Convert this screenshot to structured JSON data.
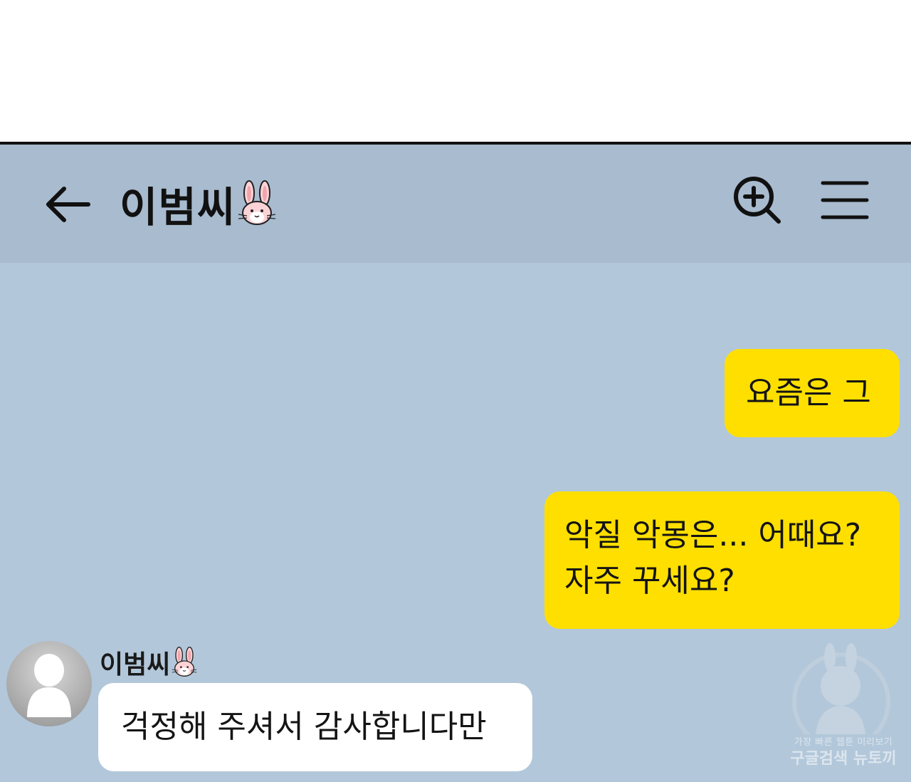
{
  "header": {
    "title": "이범씨",
    "back_icon": "arrow-left-icon",
    "search_icon": "zoom-in-search-icon",
    "menu_icon": "hamburger-menu-icon",
    "title_emoji": "rabbit-face-icon"
  },
  "messages": [
    {
      "from": "me",
      "lines": [
        "요즘은 그"
      ]
    },
    {
      "from": "me",
      "lines": [
        "악질 악몽은... 어때요?",
        "자주 꾸세요?"
      ]
    },
    {
      "from": "other",
      "sender": "이범씨",
      "lines": [
        "걱정해 주셔서 감사합니다만"
      ]
    }
  ],
  "watermark": {
    "tagline": "가장 빠른 웹툰 미리보기",
    "brand": "구글검색 뉴토끼"
  },
  "colors": {
    "header_bg": "#a8bbcf",
    "chat_bg": "#b2c7da",
    "my_bubble": "#fedf00",
    "other_bubble": "#ffffff"
  }
}
